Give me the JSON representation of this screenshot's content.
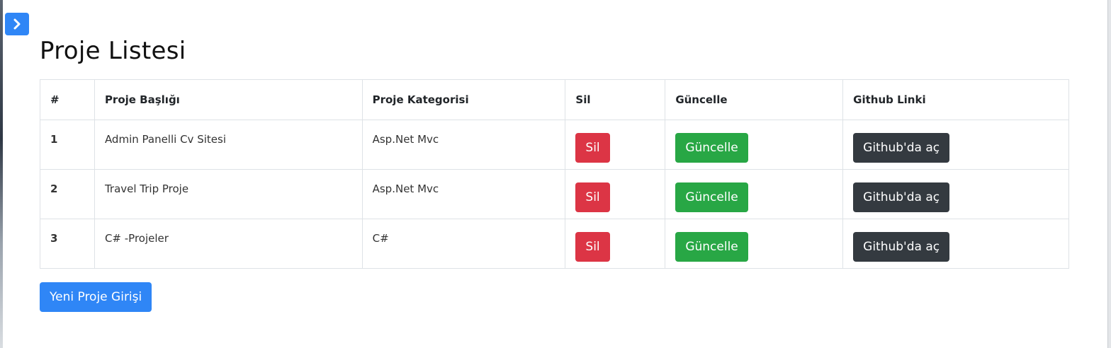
{
  "sidebar_toggle": {
    "icon": "chevron-right-icon"
  },
  "page": {
    "title": "Proje Listesi"
  },
  "table": {
    "headers": [
      "#",
      "Proje Başlığı",
      "Proje Kategorisi",
      "Sil",
      "Güncelle",
      "Github Linki"
    ],
    "rows": [
      {
        "id": "1",
        "title": "Admin Panelli Cv Sitesi",
        "category": "Asp.Net Mvc",
        "delete_label": "Sil",
        "update_label": "Güncelle",
        "github_label": "Github'da aç"
      },
      {
        "id": "2",
        "title": "Travel Trip Proje",
        "category": "Asp.Net Mvc",
        "delete_label": "Sil",
        "update_label": "Güncelle",
        "github_label": "Github'da aç"
      },
      {
        "id": "3",
        "title": "C# -Projeler",
        "category": "C#",
        "delete_label": "Sil",
        "update_label": "Güncelle",
        "github_label": "Github'da aç"
      }
    ]
  },
  "new_project_button": {
    "label": "Yeni Proje Girişi"
  },
  "colors": {
    "primary": "#2f86f6",
    "danger": "#dc3545",
    "success": "#28a745",
    "dark": "#343a40"
  }
}
